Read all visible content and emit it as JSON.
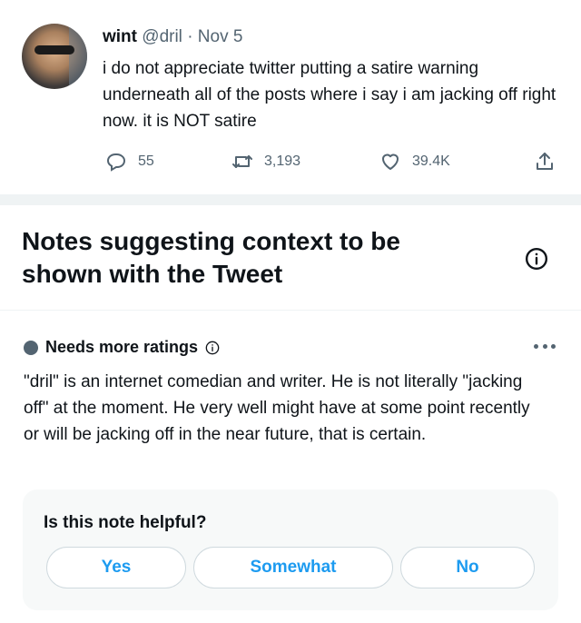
{
  "tweet": {
    "display_name": "wint",
    "handle": "@dril",
    "separator": "·",
    "date": "Nov 5",
    "text": "i do not appreciate twitter putting a satire warning underneath all of the posts where i say i am jacking off right now. it is NOT satire",
    "replies": "55",
    "retweets": "3,193",
    "likes": "39.4K",
    "icons": {
      "reply": "reply-icon",
      "retweet": "retweet-icon",
      "like": "heart-icon",
      "share": "share-icon"
    }
  },
  "notes_section": {
    "title": "Notes suggesting context to be shown with the Tweet",
    "info_icon": "info-icon"
  },
  "note": {
    "status": "Needs more ratings",
    "status_color": "#536471",
    "text": "\"dril\" is an internet comedian and writer. He is not literally \"jacking off\" at the moment. He very well might have at some point recently or will be jacking off in the near future, that is certain.",
    "more_icon": "more-options-icon"
  },
  "helpful_prompt": {
    "question": "Is this note helpful?",
    "options": [
      "Yes",
      "Somewhat",
      "No"
    ]
  },
  "colors": {
    "accent": "#1d9bf0",
    "text": "#0f1419",
    "muted": "#536471",
    "panel": "#f7f9f9",
    "separator": "#eff3f4"
  }
}
